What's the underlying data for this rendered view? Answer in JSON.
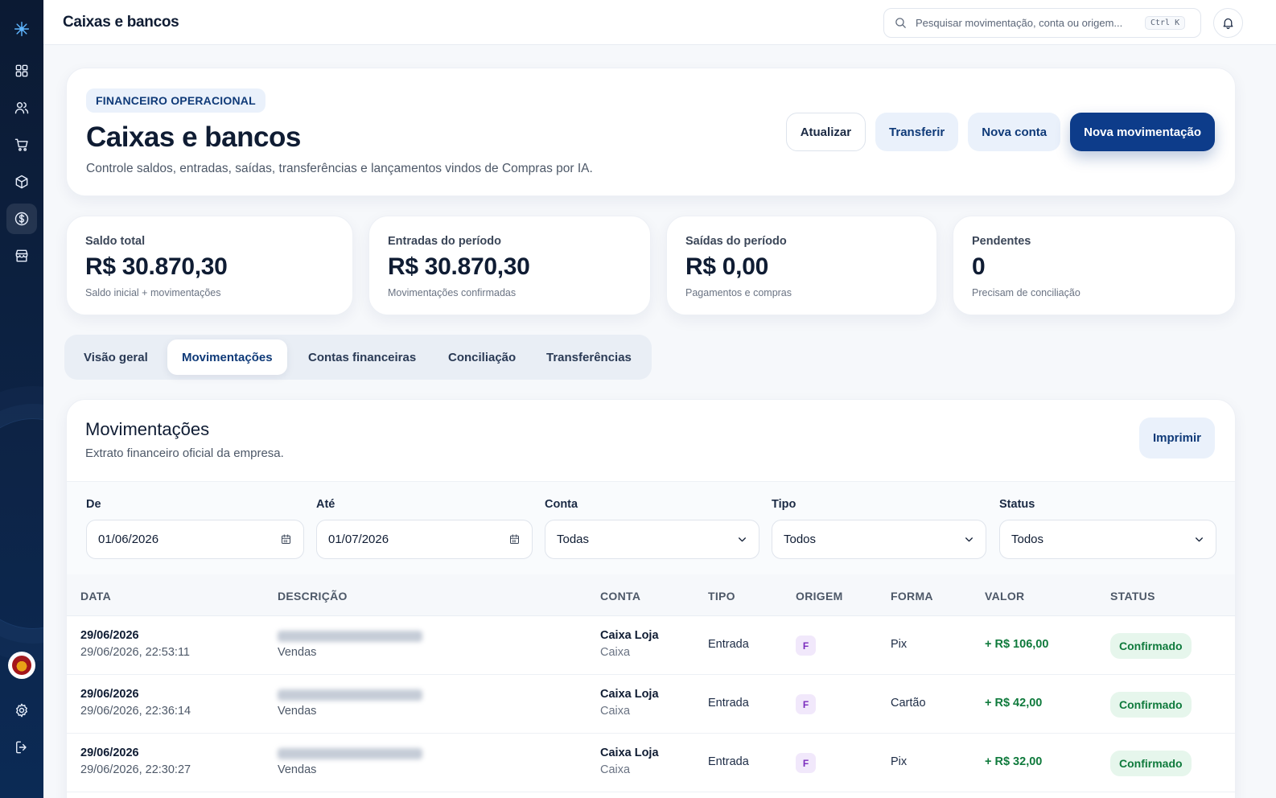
{
  "sidebar": {
    "items": [
      {
        "name": "logo-icon"
      },
      {
        "name": "dashboard-icon"
      },
      {
        "name": "users-icon"
      },
      {
        "name": "cart-icon"
      },
      {
        "name": "box-icon"
      },
      {
        "name": "dollar-icon",
        "active": true
      },
      {
        "name": "store-icon"
      }
    ],
    "bottom": [
      {
        "name": "avatar"
      },
      {
        "name": "gear-icon"
      },
      {
        "name": "logout-icon"
      }
    ]
  },
  "topbar": {
    "title": "Caixas e bancos",
    "search_placeholder": "Pesquisar movimentação, conta ou origem...",
    "search_shortcut": "Ctrl K"
  },
  "hero": {
    "badge": "FINANCEIRO OPERACIONAL",
    "title": "Caixas e bancos",
    "subtitle": "Controle saldos, entradas, saídas, transferências e lançamentos vindos de Compras por IA.",
    "actions": {
      "refresh": "Atualizar",
      "transfer": "Transferir",
      "new_account": "Nova conta",
      "new_movement": "Nova movimentação"
    }
  },
  "stats": [
    {
      "label": "Saldo total",
      "value": "R$ 30.870,30",
      "sub": "Saldo inicial + movimentações"
    },
    {
      "label": "Entradas do período",
      "value": "R$ 30.870,30",
      "sub": "Movimentações confirmadas"
    },
    {
      "label": "Saídas do período",
      "value": "R$ 0,00",
      "sub": "Pagamentos e compras"
    },
    {
      "label": "Pendentes",
      "value": "0",
      "sub": "Precisam de conciliação"
    }
  ],
  "tabs": [
    {
      "label": "Visão geral"
    },
    {
      "label": "Movimentações",
      "active": true
    },
    {
      "label": "Contas financeiras"
    },
    {
      "label": "Conciliação"
    },
    {
      "label": "Transferências"
    }
  ],
  "panel": {
    "title": "Movimentações",
    "description": "Extrato financeiro oficial da empresa.",
    "print": "Imprimir"
  },
  "filters": {
    "from": {
      "label": "De",
      "value": "01/06/2026"
    },
    "to": {
      "label": "Até",
      "value": "01/07/2026"
    },
    "account": {
      "label": "Conta",
      "value": "Todas"
    },
    "type": {
      "label": "Tipo",
      "value": "Todos"
    },
    "status": {
      "label": "Status",
      "value": "Todos"
    }
  },
  "table": {
    "headers": [
      "DATA",
      "DESCRIÇÃO",
      "CONTA",
      "TIPO",
      "ORIGEM",
      "FORMA",
      "VALOR",
      "STATUS"
    ],
    "rows": [
      {
        "date": "29/06/2026",
        "datetime": "29/06/2026, 22:53:11",
        "category": "Vendas",
        "account": "Caixa Loja",
        "account_type": "Caixa",
        "type": "Entrada",
        "origin": "F",
        "method": "Pix",
        "value": "+ R$ 106,00",
        "status": "Confirmado"
      },
      {
        "date": "29/06/2026",
        "datetime": "29/06/2026, 22:36:14",
        "category": "Vendas",
        "account": "Caixa Loja",
        "account_type": "Caixa",
        "type": "Entrada",
        "origin": "F",
        "method": "Cartão",
        "value": "+ R$ 42,00",
        "status": "Confirmado"
      },
      {
        "date": "29/06/2026",
        "datetime": "29/06/2026, 22:30:27",
        "category": "Vendas",
        "account": "Caixa Loja",
        "account_type": "Caixa",
        "type": "Entrada",
        "origin": "F",
        "method": "Pix",
        "value": "+ R$ 32,00",
        "status": "Confirmado"
      }
    ]
  },
  "colors": {
    "sidebar": "#0b1a33",
    "primary": "#0d3c8a",
    "positive": "#0f7a3c",
    "origin_badge": "#7a2bbd"
  }
}
